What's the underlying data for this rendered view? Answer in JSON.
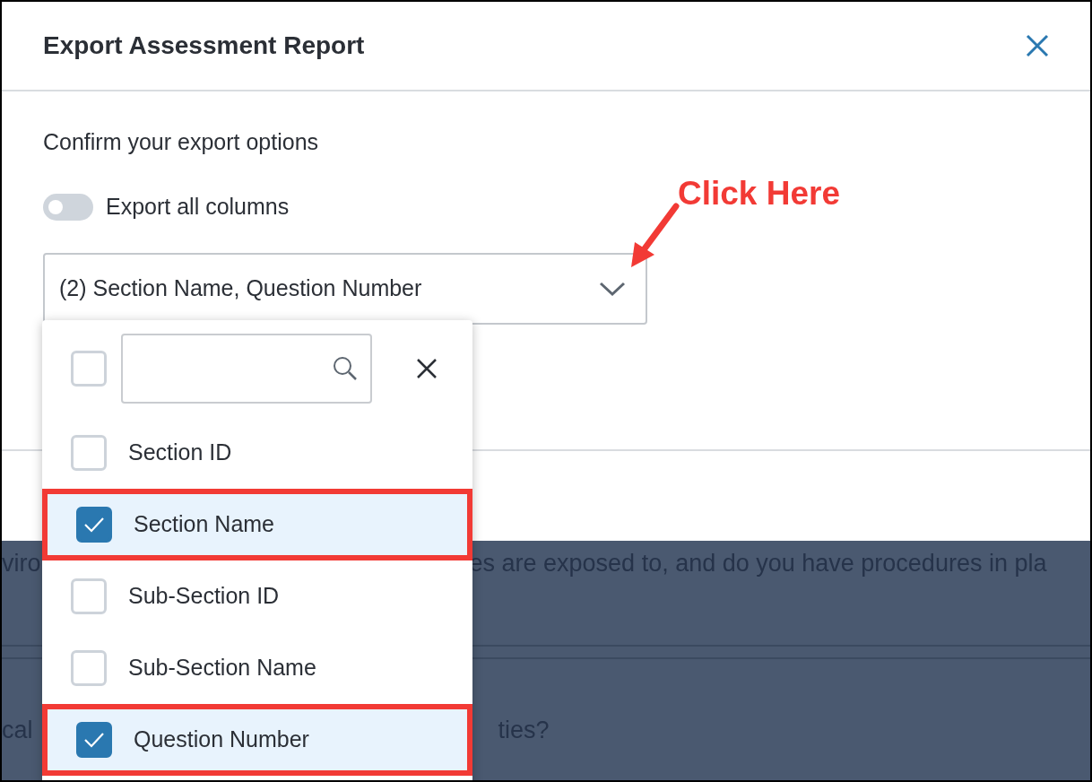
{
  "dialog": {
    "title": "Export Assessment Report",
    "subtitle": "Confirm your export options",
    "toggle": {
      "label": "Export all columns",
      "on": false
    },
    "select": {
      "value": "(2) Section Name, Question Number",
      "expanded": true
    }
  },
  "dropdown": {
    "select_all": {
      "checked": false
    },
    "items": [
      {
        "label": "Section ID",
        "checked": false,
        "highlighted": false
      },
      {
        "label": "Section Name",
        "checked": true,
        "highlighted": true
      },
      {
        "label": "Sub-Section ID",
        "checked": false,
        "highlighted": false
      },
      {
        "label": "Sub-Section Name",
        "checked": false,
        "highlighted": false
      },
      {
        "label": "Question Number",
        "checked": true,
        "highlighted": true
      }
    ]
  },
  "annotation": {
    "text": "Click Here"
  },
  "background": {
    "lines": [
      {
        "left": "viro",
        "right": "es are exposed to, and do you have procedures in pla"
      },
      {
        "left": "cal",
        "right": "ties?"
      }
    ]
  }
}
